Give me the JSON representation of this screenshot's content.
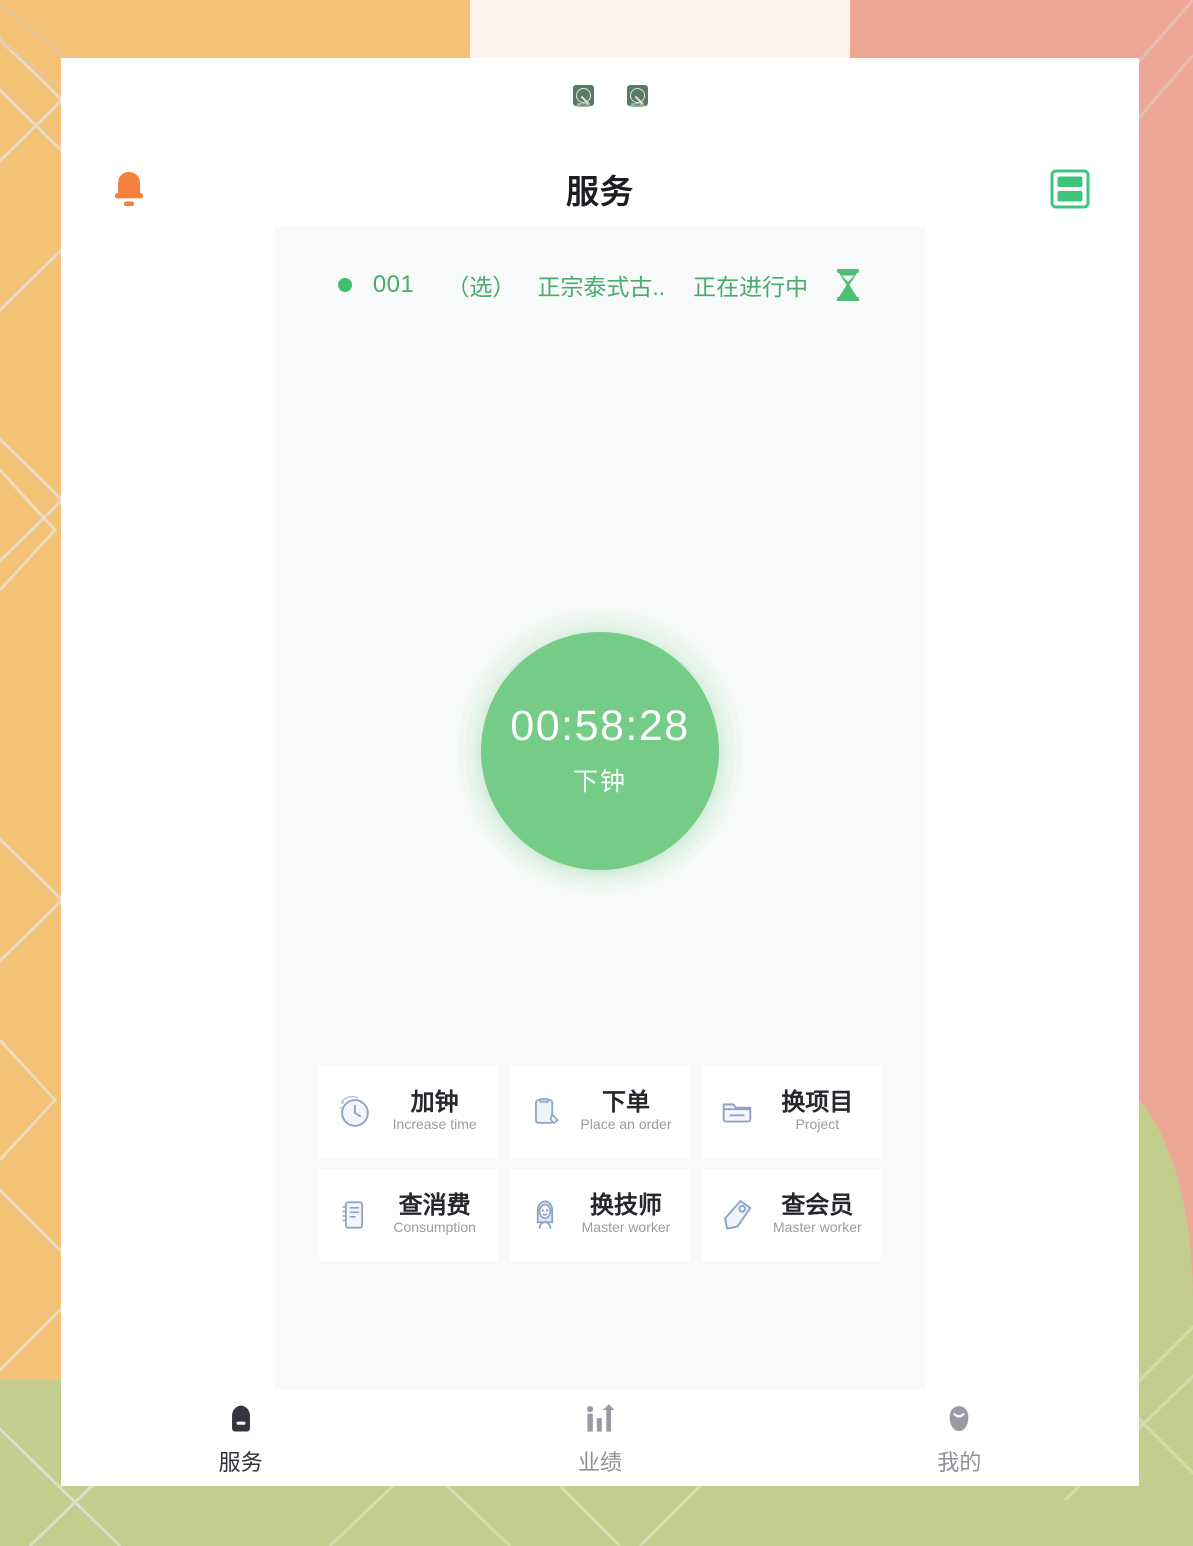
{
  "theme": {
    "accent_green": "#4bab6d",
    "timer_green": "#74cc87",
    "bell_orange": "#f4813f",
    "scan_green": "#3fc47c",
    "panel_bg": "#f7f9fa",
    "bg_cream": "#fdf3ea",
    "bg_amber": "#f3c277",
    "bg_salmon": "#eda794",
    "bg_olive": "#c3ce8e"
  },
  "statusbar": {
    "icons": [
      {
        "name": "broken-image-icon-1",
        "caption": "IMG"
      },
      {
        "name": "broken-image-icon-2",
        "caption": "IMG"
      }
    ]
  },
  "header": {
    "bell_icon": "bell-icon",
    "title": "服务",
    "scan_icon": "scan-code-icon"
  },
  "order": {
    "status_dot": "status-dot-active",
    "number": "001",
    "tag": "（选）",
    "project": "正宗泰式古..",
    "state": "正在进行中",
    "progress_icon": "hourglass-icon"
  },
  "timer": {
    "time": "00:58:28",
    "label": "下钟"
  },
  "actions": [
    {
      "icon": "clock-icon",
      "cn": "加钟",
      "en": "Increase time"
    },
    {
      "icon": "order-note-icon",
      "cn": "下单",
      "en": "Place an order"
    },
    {
      "icon": "folder-icon",
      "cn": "换项目",
      "en": "Project"
    },
    {
      "icon": "notebook-icon",
      "cn": "查消费",
      "en": "Consumption"
    },
    {
      "icon": "technician-icon",
      "cn": "换技师",
      "en": "Master worker"
    },
    {
      "icon": "tag-icon",
      "cn": "查会员",
      "en": "Master worker"
    }
  ],
  "tabs": [
    {
      "icon": "home-icon",
      "label": "服务",
      "active": true
    },
    {
      "icon": "chart-icon",
      "label": "业绩",
      "active": false
    },
    {
      "icon": "person-icon",
      "label": "我的",
      "active": false
    }
  ]
}
